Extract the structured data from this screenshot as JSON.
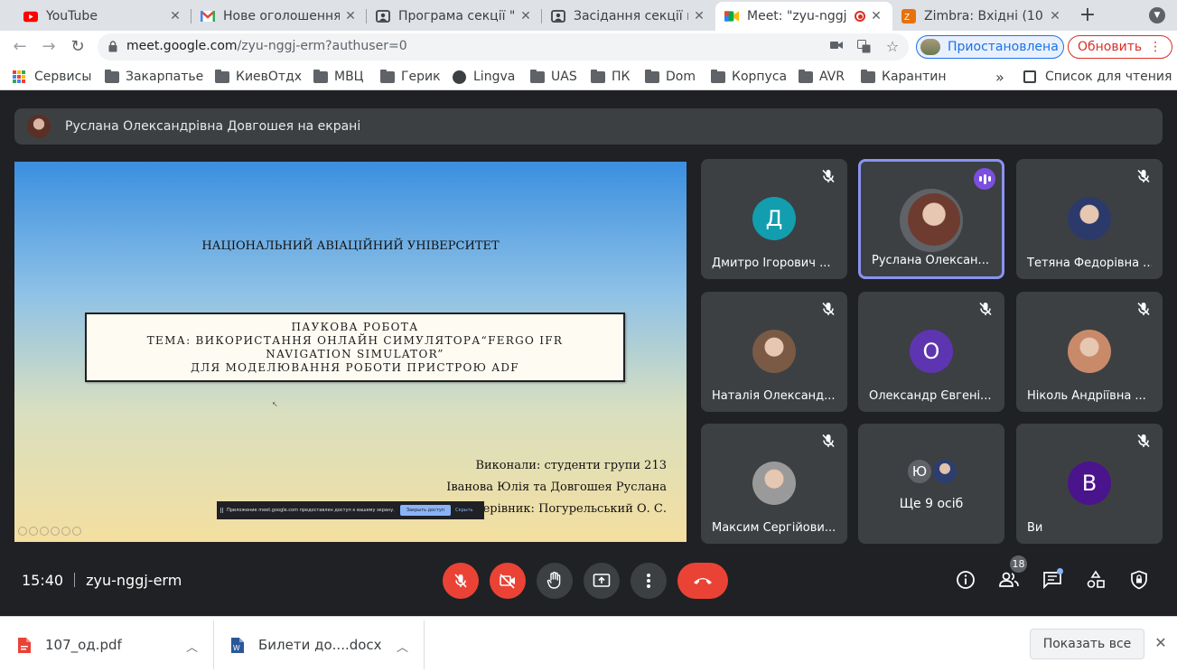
{
  "browser": {
    "tabs": [
      {
        "title": "YouTube",
        "icon": "youtube-icon",
        "active": false
      },
      {
        "title": "Нове оголошення",
        "icon": "gmail-icon",
        "active": false
      },
      {
        "title": "Програма секції \"А",
        "icon": "meet-page-icon",
        "active": false
      },
      {
        "title": "Засідання секції кс",
        "icon": "meet-page-icon",
        "active": false
      },
      {
        "title": "Meet: \"zyu-nggj",
        "icon": "google-meet-icon",
        "active": true
      },
      {
        "title": "Zimbra: Вхідні (10",
        "icon": "zimbra-icon",
        "active": false
      }
    ],
    "close_glyph": "✕",
    "new_tab_glyph": "+",
    "url_host": "meet.google.com",
    "url_path": "/zyu-nggj-erm?authuser=0",
    "profile_label": "Приостановлена",
    "update_label": "Обновить",
    "bookmarks": [
      {
        "label": "Сервисы",
        "icon": "apps-grid-icon"
      },
      {
        "label": "Закарпатье",
        "icon": "folder-icon"
      },
      {
        "label": "КиевОтдх",
        "icon": "folder-icon"
      },
      {
        "label": "МВЦ",
        "icon": "folder-icon"
      },
      {
        "label": "Герик",
        "icon": "folder-icon"
      },
      {
        "label": "Lingva",
        "icon": "globe-icon"
      },
      {
        "label": "UAS",
        "icon": "folder-icon"
      },
      {
        "label": "ПК",
        "icon": "folder-icon"
      },
      {
        "label": "Dom",
        "icon": "folder-icon"
      },
      {
        "label": "Корпуса",
        "icon": "folder-icon"
      },
      {
        "label": "AVR",
        "icon": "folder-icon"
      },
      {
        "label": "Карантин",
        "icon": "folder-icon"
      }
    ],
    "bookmarks_overflow": "»",
    "reading_list_label": "Список для чтения"
  },
  "meet": {
    "banner_text": "Руслана Олександрівна Довгошея на екрані",
    "slide": {
      "university": "НАЦІОНАЛЬНИЙ АВІАЦІЙНИЙ УНІВЕРСИТЕТ",
      "box_lines": [
        "ПАУКОВА РОБОТА",
        "ТЕМА: ВИКОРИСТАННЯ ОНЛАЙН СИМУЛЯТОРА“FERGO IFR",
        "NAVIGATION SIMULATOR”",
        "ДЛЯ МОДЕЛЮВАННЯ РОБОТИ ПРИСТРОЮ ADF"
      ],
      "performed_by": "Виконали: студенти групи 213",
      "students": "Іванова Юлія та Довгошея Руслана",
      "supervisor": "Керівник: Погурельський О. С.",
      "share_notice": "Приложение meet.google.com предоставлен доступ к вашему экрану.",
      "share_stop": "Закрыть доступ",
      "share_hide": "Скрыть"
    },
    "participants": [
      {
        "name": "Дмитро Ігорович ...",
        "initial": "Д",
        "color": "#129eaf",
        "muted": true,
        "speaking": false
      },
      {
        "name": "Руслана Олексан...",
        "initial": "",
        "color": "#6e3b30",
        "muted": false,
        "speaking": true
      },
      {
        "name": "Тетяна Федорівна ...",
        "initial": "",
        "color": "#2b3a6a",
        "muted": true,
        "speaking": false
      },
      {
        "name": "Наталія Олександ...",
        "initial": "",
        "color": "#7a5a44",
        "muted": true,
        "speaking": false
      },
      {
        "name": "Олександр Євгені...",
        "initial": "О",
        "color": "#5e35b1",
        "muted": true,
        "speaking": false
      },
      {
        "name": "Ніколь Андріївна ...",
        "initial": "",
        "color": "#c98a6a",
        "muted": true,
        "speaking": false
      },
      {
        "name": "Максим Сергійови...",
        "initial": "",
        "color": "#9a9a9a",
        "muted": true,
        "speaking": false
      },
      {
        "name": "Ще 9 осіб",
        "initial": "Ю",
        "color": "#5f6368",
        "muted": false,
        "speaking": false
      },
      {
        "name": "Ви",
        "initial": "В",
        "color": "#4a148c",
        "muted": true,
        "speaking": false
      }
    ],
    "time": "15:40",
    "meeting_code": "zyu-nggj-erm",
    "people_count": "18",
    "accent_red": "#ea4335"
  },
  "downloads": {
    "files": [
      {
        "name": "107_од.pdf",
        "icon": "pdf-file-icon"
      },
      {
        "name": "Билети до....docx",
        "icon": "docx-file-icon"
      }
    ],
    "show_all": "Показать все",
    "close_glyph": "✕"
  }
}
